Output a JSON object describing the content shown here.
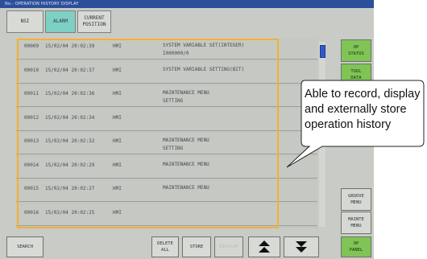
{
  "window": {
    "title": "No.- OPERATION HISTORY DISPLAY"
  },
  "tabs": [
    {
      "label": "NSI"
    },
    {
      "label": "ALARM"
    },
    {
      "label": "CURRENT\nPOSITION"
    }
  ],
  "history": [
    {
      "no": "00009",
      "time": "15/02/04 20:02:39",
      "source": "HMI",
      "message": "SYSTEM VARIABLE SET(INTEGER)\nI000000/0"
    },
    {
      "no": "00010",
      "time": "15/02/04 20:02:37",
      "source": "HMI",
      "message": "SYSTEM VARIABLE SETTING(BIT)"
    },
    {
      "no": "00011",
      "time": "15/02/04 20:02:36",
      "source": "HMI",
      "message": "MAINTENANCE MENU\nSETTING"
    },
    {
      "no": "00012",
      "time": "15/02/04 20:02:34",
      "source": "HMI",
      "message": ""
    },
    {
      "no": "00013",
      "time": "15/02/04 20:02:32",
      "source": "HMI",
      "message": "MAINTENANCE MENU\nSETTING"
    },
    {
      "no": "00014",
      "time": "15/02/04 20:02:29",
      "source": "HMI",
      "message": "MAINTENANCE MENU"
    },
    {
      "no": "00015",
      "time": "15/02/04 20:02:27",
      "source": "HMI",
      "message": "MAINTENANCE MENU"
    },
    {
      "no": "00016",
      "time": "15/02/04 20:02:25",
      "source": "HMI",
      "message": ""
    }
  ],
  "side_buttons": {
    "op_status": "OP\nSTATUS",
    "tool_data": "TOOL\nDATA",
    "groove_menu": "GROOVE\nMENU",
    "mainte_menu": "MAINTE\nMENU",
    "op_panel": "OP\nPANEL"
  },
  "bottom_buttons": {
    "search": "SEARCH",
    "delete_all": "DELETE\nALL",
    "store": "STORE",
    "display": "DISPLAY"
  },
  "callout": {
    "text": "Able to record, display and externally store operation history"
  },
  "colors": {
    "highlight": "#f2b22e",
    "alarm_tab": "#7fd0c4",
    "green_button": "#7fc455"
  }
}
